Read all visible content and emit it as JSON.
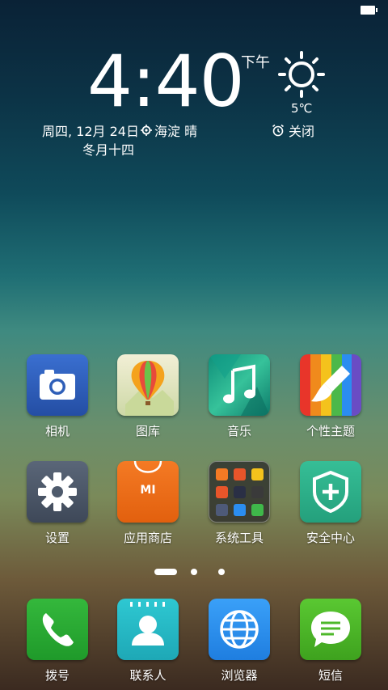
{
  "status": {
    "battery_level": 1.0
  },
  "clock": {
    "time": "4:40",
    "ampm": "下午",
    "temperature": "5℃",
    "date": "周四, 12月 24日",
    "location": "海淀 晴",
    "lunar": "冬月十四",
    "alarm": "关闭",
    "weather_icon": "sun-icon"
  },
  "apps": [
    {
      "label": "相机",
      "icon": "camera-icon",
      "color": "#2f5fb8"
    },
    {
      "label": "图库",
      "icon": "balloon-icon",
      "color": "#e8e2b8"
    },
    {
      "label": "音乐",
      "icon": "music-note-icon",
      "color": "#1fa38a"
    },
    {
      "label": "个性主题",
      "icon": "paintbrush-icon",
      "color": "#e8552a"
    },
    {
      "label": "设置",
      "icon": "gear-icon",
      "color": "#4e5a6c"
    },
    {
      "label": "应用商店",
      "icon": "shopping-bag-icon",
      "color": "#f06c1a",
      "text": "MI"
    },
    {
      "label": "系统工具",
      "icon": "folder-icon",
      "color": "#2a2a2a"
    },
    {
      "label": "安全中心",
      "icon": "shield-plus-icon",
      "color": "#2eae8a"
    }
  ],
  "dock": [
    {
      "label": "拨号",
      "icon": "phone-icon",
      "color": "#2aa534"
    },
    {
      "label": "联系人",
      "icon": "contact-icon",
      "color": "#23bfc9"
    },
    {
      "label": "浏览器",
      "icon": "globe-icon",
      "color": "#2b8df0"
    },
    {
      "label": "短信",
      "icon": "message-icon",
      "color": "#4db82a"
    }
  ],
  "pages": {
    "count": 3,
    "current": 1
  }
}
